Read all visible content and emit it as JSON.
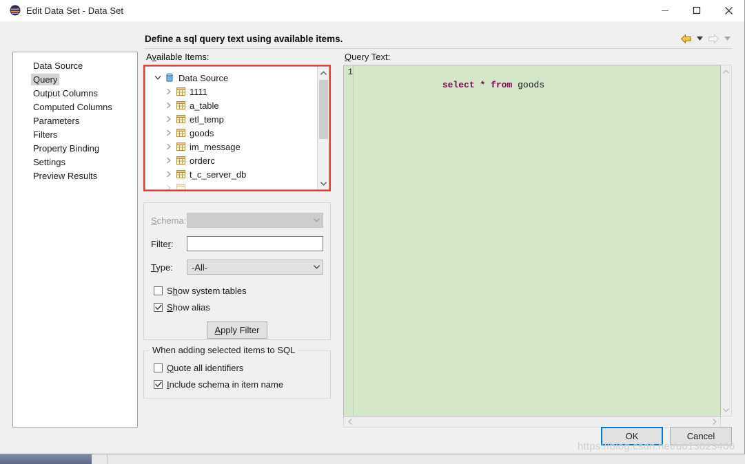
{
  "window": {
    "title": "Edit Data Set - Data Set",
    "icon": "eclipse-birt-icon",
    "controls": {
      "minimize": "minimize-icon",
      "maximize": "maximize-icon",
      "close": "close-icon"
    }
  },
  "header": {
    "title": "Define a sql query text using available items.",
    "nav": {
      "back": "back-arrow-icon",
      "back_menu": "chevron-down-icon",
      "forward": "forward-arrow-icon",
      "forward_menu": "chevron-down-icon"
    }
  },
  "sidebar": {
    "items": [
      {
        "label": "Data Source",
        "selected": false
      },
      {
        "label": "Query",
        "selected": true
      },
      {
        "label": "Output Columns",
        "selected": false
      },
      {
        "label": "Computed Columns",
        "selected": false
      },
      {
        "label": "Parameters",
        "selected": false
      },
      {
        "label": "Filters",
        "selected": false
      },
      {
        "label": "Property Binding",
        "selected": false
      },
      {
        "label": "Settings",
        "selected": false
      },
      {
        "label": "Preview Results",
        "selected": false
      }
    ]
  },
  "available_items": {
    "label": "Available Items:",
    "mnemonic": "v",
    "highlight_color": "#ea3a32",
    "tree": {
      "root": {
        "label": "Data Source",
        "icon": "database-icon",
        "expanded": true
      },
      "children": [
        {
          "label": "1111",
          "icon": "table-icon"
        },
        {
          "label": "a_table",
          "icon": "table-icon"
        },
        {
          "label": "etl_temp",
          "icon": "table-icon"
        },
        {
          "label": "goods",
          "icon": "table-icon"
        },
        {
          "label": "im_message",
          "icon": "table-icon"
        },
        {
          "label": "orderc",
          "icon": "table-icon"
        },
        {
          "label": "t_c_server_db",
          "icon": "table-icon"
        }
      ]
    }
  },
  "filters": {
    "schema": {
      "label": "Schema:",
      "mnemonic": "S",
      "value": "",
      "disabled": true
    },
    "filter": {
      "label": "Filter:",
      "mnemonic": "r",
      "value": "",
      "placeholder": ""
    },
    "type": {
      "label": "Type:",
      "mnemonic": "T",
      "value": "-All-",
      "options": [
        "-All-"
      ]
    },
    "show_system_tables": {
      "label": "Show system tables",
      "mnemonic": "h",
      "checked": false
    },
    "show_alias": {
      "label": "Show alias",
      "mnemonic": "S",
      "checked": true
    },
    "apply_button": {
      "label": "Apply Filter",
      "mnemonic": "A"
    }
  },
  "sql_options": {
    "group_title": "When adding selected items to SQL",
    "quote_all": {
      "label": "Quote all identifiers",
      "mnemonic": "Q",
      "checked": false
    },
    "include_schema": {
      "label": "Include schema in item name",
      "mnemonic": "I",
      "checked": true
    }
  },
  "query": {
    "label": "Query Text:",
    "mnemonic": "Q",
    "background_color": "#d4e8c9",
    "keyword_color": "#7d0552",
    "lines": [
      {
        "number": "1",
        "tokens": [
          {
            "text": "select",
            "type": "keyword"
          },
          {
            "text": " ",
            "type": "plain"
          },
          {
            "text": "*",
            "type": "operator"
          },
          {
            "text": " ",
            "type": "plain"
          },
          {
            "text": "from",
            "type": "keyword"
          },
          {
            "text": " goods",
            "type": "identifier"
          }
        ]
      }
    ],
    "full_text": "select * from goods"
  },
  "footer": {
    "ok": "OK",
    "cancel": "Cancel",
    "default_button_color": "#0078d7"
  },
  "watermark": "https://blog.csdn.net/u013023406"
}
